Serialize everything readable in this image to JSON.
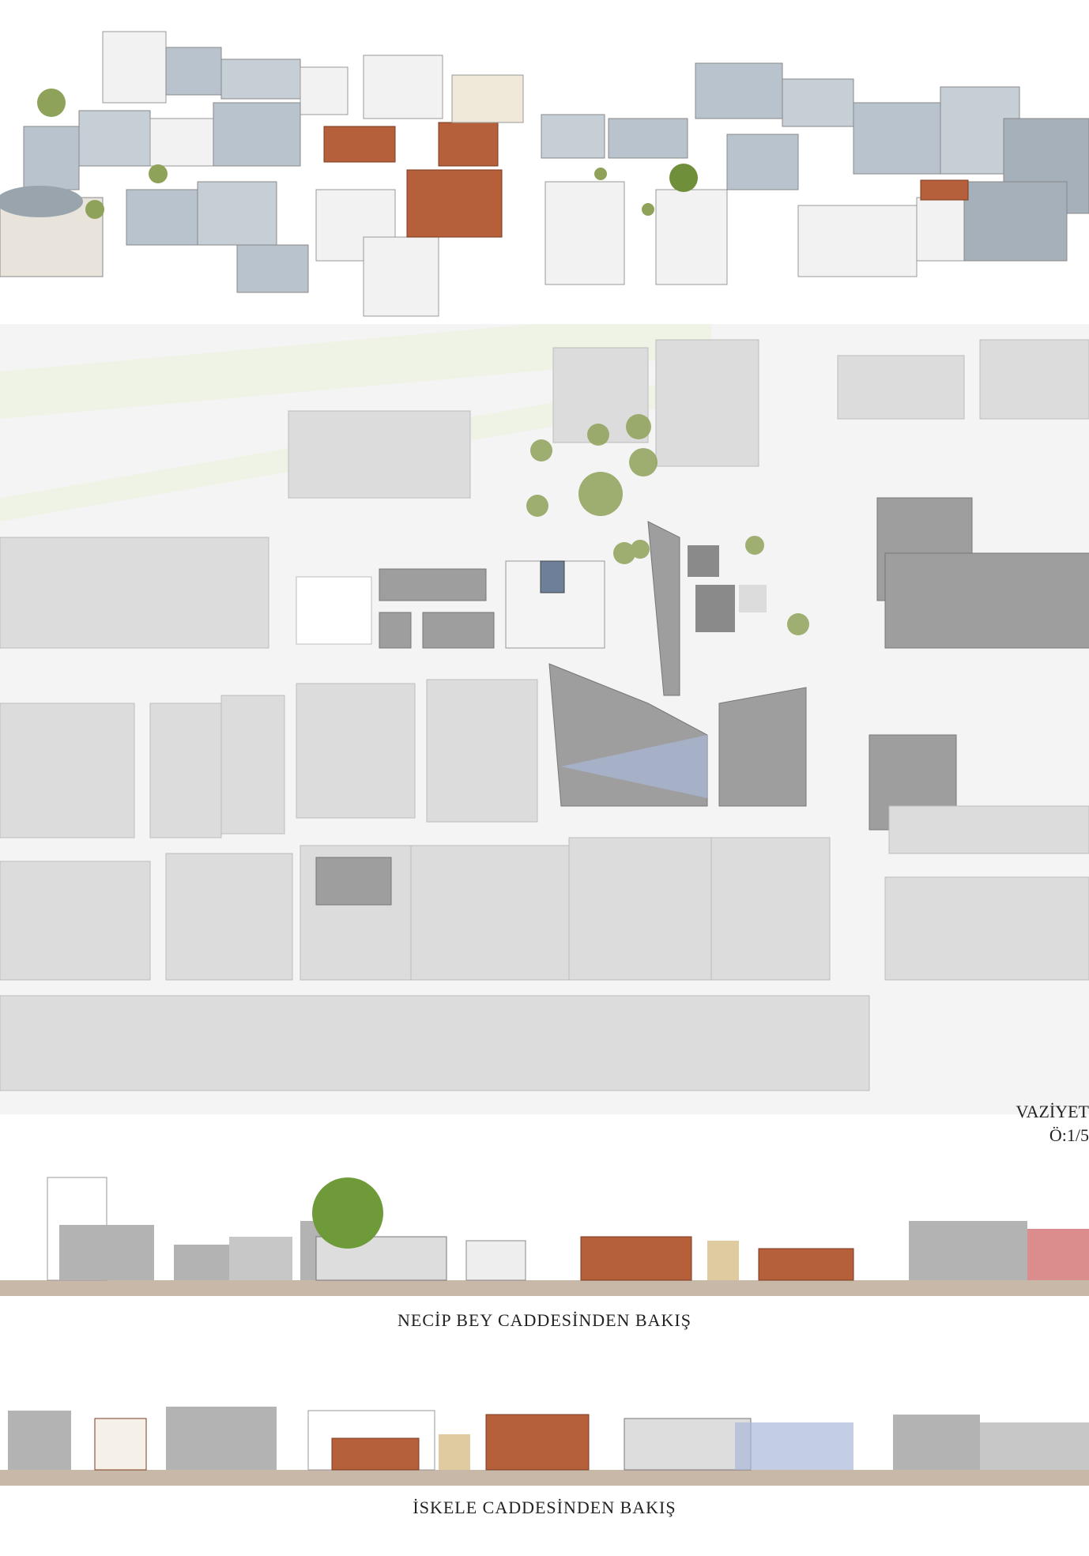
{
  "plan": {
    "title": "VAZİYET",
    "scale": "Ö:1/5"
  },
  "elevations": [
    {
      "caption": "NECİP BEY CADDESİNDEN BAKIŞ"
    },
    {
      "caption": "İSKELE  CADDESİNDEN  BAKIŞ"
    }
  ],
  "colors": {
    "building_grey": "#b9c3cd",
    "roof_white": "#f2f2f2",
    "brick": "#b5603a",
    "plan_block": "#dcdcdc",
    "plan_dark": "#9e9e9e",
    "tree": "#8fa25a",
    "ground": "#c8b8a8",
    "water_blue": "#a9b8d8"
  }
}
